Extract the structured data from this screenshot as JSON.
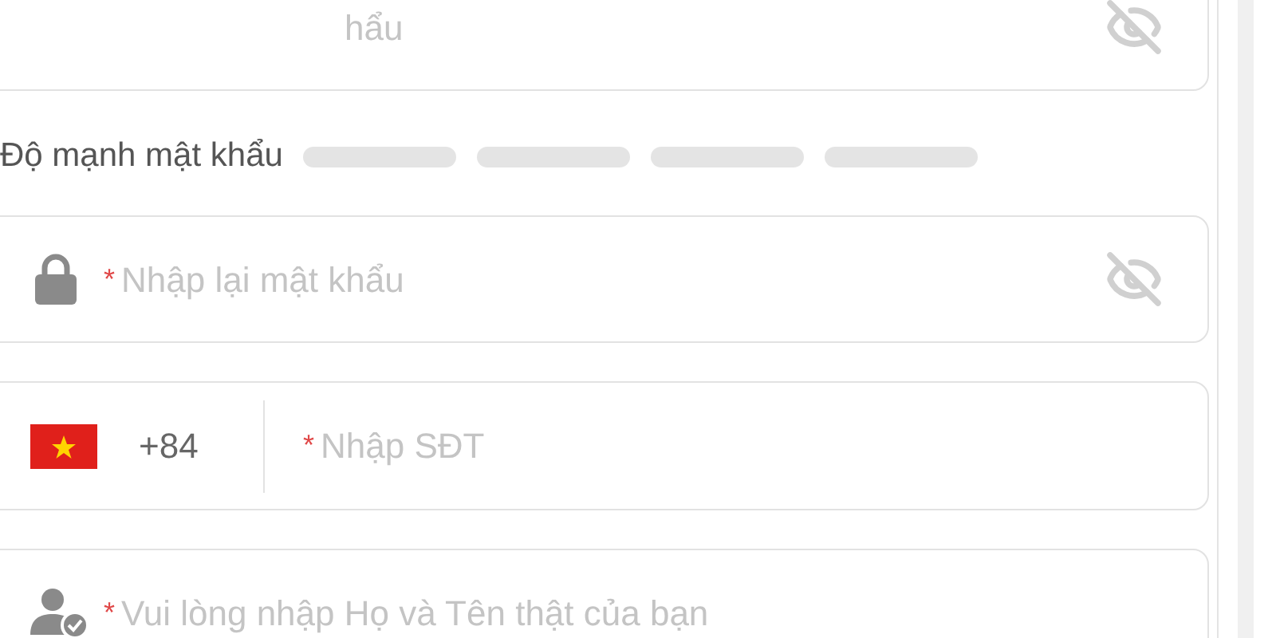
{
  "password_field": {
    "placeholder": "hẩu",
    "masked": true
  },
  "strength": {
    "label": "Độ mạnh mật khẩu",
    "bars": [
      {
        "filled": false
      },
      {
        "filled": false
      },
      {
        "filled": false
      },
      {
        "filled": false
      }
    ]
  },
  "confirm_field": {
    "required_mark": "*",
    "placeholder": "Nhập lại mật khẩu",
    "masked": true
  },
  "phone_field": {
    "country_code": "+84",
    "required_mark": "*",
    "placeholder": "Nhập SĐT"
  },
  "name_field": {
    "required_mark": "*",
    "placeholder": "Vui lòng nhập Họ và Tên thật của bạn"
  }
}
